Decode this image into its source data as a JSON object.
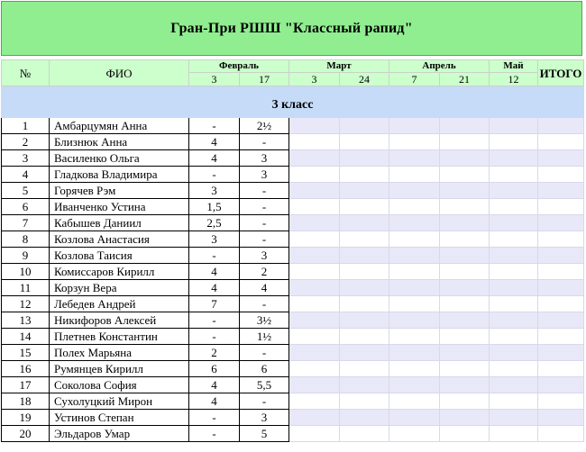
{
  "title": "Гран-При РШШ \"Классный рапид\"",
  "header": {
    "num": "№",
    "fio": "ФИО",
    "itogo": "ИТОГО",
    "months": [
      {
        "name": "Февраль",
        "stages": [
          "3",
          "17"
        ]
      },
      {
        "name": "Март",
        "stages": [
          "3",
          "24"
        ]
      },
      {
        "name": "Апрель",
        "stages": [
          "7",
          "21"
        ]
      },
      {
        "name": "Май",
        "stages": [
          "12"
        ]
      }
    ]
  },
  "class_label": "3 класс",
  "rows": [
    {
      "n": "1",
      "name": "Амбарцумян Анна",
      "s1": "-",
      "s2": "2½"
    },
    {
      "n": "2",
      "name": "Близнюк Анна",
      "s1": "4",
      "s2": "-"
    },
    {
      "n": "3",
      "name": "Василенко Ольга",
      "s1": "4",
      "s2": "3"
    },
    {
      "n": "4",
      "name": "Гладкова Владимира",
      "s1": "-",
      "s2": "3"
    },
    {
      "n": "5",
      "name": "Горячев Рэм",
      "s1": "3",
      "s2": "-"
    },
    {
      "n": "6",
      "name": "Иванченко Устина",
      "s1": "1,5",
      "s2": "-"
    },
    {
      "n": "7",
      "name": "Кабышев Даниил",
      "s1": "2,5",
      "s2": "-"
    },
    {
      "n": "8",
      "name": "Козлова Анастасия",
      "s1": "3",
      "s2": "-"
    },
    {
      "n": "9",
      "name": "Козлова Таисия",
      "s1": "-",
      "s2": "3"
    },
    {
      "n": "10",
      "name": "Комиссаров Кирилл",
      "s1": "4",
      "s2": "2"
    },
    {
      "n": "11",
      "name": "Корзун Вера",
      "s1": "4",
      "s2": "4"
    },
    {
      "n": "12",
      "name": "Лебедев Андрей",
      "s1": "7",
      "s2": "-"
    },
    {
      "n": "13",
      "name": "Никифоров Алексей",
      "s1": "-",
      "s2": "3½"
    },
    {
      "n": "14",
      "name": "Плетнев Константин",
      "s1": "-",
      "s2": "1½"
    },
    {
      "n": "15",
      "name": "Полех Марьяна",
      "s1": "2",
      "s2": "-"
    },
    {
      "n": "16",
      "name": "Румянцев Кирилл",
      "s1": "6",
      "s2": "6"
    },
    {
      "n": "17",
      "name": "Соколова София",
      "s1": "4",
      "s2": "5,5"
    },
    {
      "n": "18",
      "name": "Сухолуцкий Мирон",
      "s1": "4",
      "s2": "-"
    },
    {
      "n": "19",
      "name": "Устинов Степан",
      "s1": "-",
      "s2": "3"
    },
    {
      "n": "20",
      "name": "Эльдаров Умар",
      "s1": "-",
      "s2": "5"
    }
  ]
}
